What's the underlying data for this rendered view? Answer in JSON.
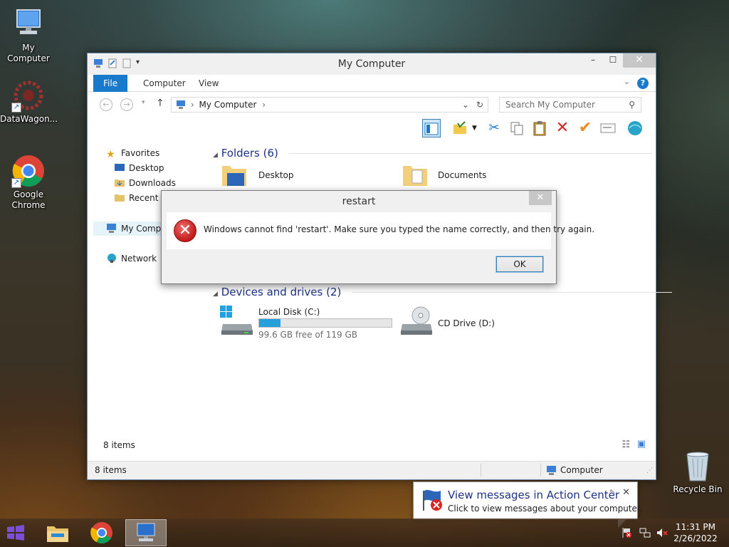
{
  "desktop": {
    "icons": [
      {
        "label": "My Computer"
      },
      {
        "label": "DataWagon..."
      },
      {
        "label": "Google Chrome"
      }
    ],
    "recycle_bin": "Recycle Bin"
  },
  "explorer": {
    "title": "My Computer",
    "tabs": {
      "file": "File",
      "computer": "Computer",
      "view": "View"
    },
    "address": "My Computer",
    "search_placeholder": "Search My Computer",
    "nav": {
      "favorites": "Favorites",
      "desktop": "Desktop",
      "downloads": "Downloads",
      "recent": "Recent p",
      "my_computer": "My Compu",
      "network": "Network"
    },
    "folders_header": "Folders (6)",
    "folders": [
      "Desktop",
      "Documents"
    ],
    "devices_header": "Devices and drives (2)",
    "drives": [
      {
        "name": "Local Disk (C:)",
        "free": "99.6 GB free of 119 GB",
        "used_fraction": 0.163
      },
      {
        "name": "CD Drive (D:)"
      }
    ],
    "item_count": "8 items",
    "status_count": "8 items",
    "status_location": "Computer"
  },
  "dialog": {
    "title": "restart",
    "message": "Windows cannot find 'restart'. Make sure you typed the name correctly, and then try again.",
    "ok_label": "OK"
  },
  "notification": {
    "title": "View messages in Action Center",
    "text": "Click to view messages about your computer."
  },
  "taskbar": {
    "time": "11:31 PM",
    "date": "2/26/2022"
  },
  "colors": {
    "accent": "#1979ca",
    "drive_bar": "#26a0da",
    "error": "#c11b1b"
  }
}
